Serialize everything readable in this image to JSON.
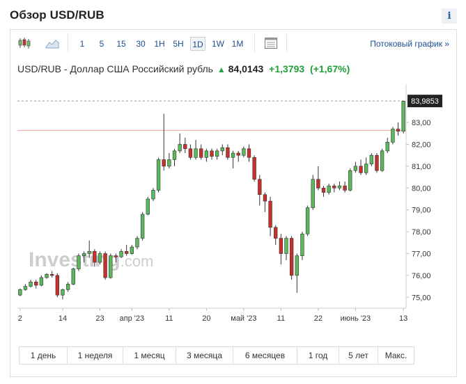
{
  "header": {
    "title": "Обзор USD/RUB",
    "info_label": "i"
  },
  "toolbar": {
    "timeframes": [
      "1",
      "5",
      "15",
      "30",
      "1H",
      "5H",
      "1D",
      "1W",
      "1M"
    ],
    "active_timeframe": "1D",
    "stream_link": "Потоковый график »"
  },
  "quote": {
    "name": "USD/RUB - Доллар США Российский рубль",
    "arrow": "▲",
    "last": "84,0143",
    "change": "+1,3793",
    "change_pct": "(+1,67%)"
  },
  "watermark": {
    "text": "Investing",
    "suffix": ".com"
  },
  "ranges": [
    "1 день",
    "1 неделя",
    "1 месяц",
    "3 месяца",
    "6 месяцев",
    "1 год",
    "5 лет",
    "Макс."
  ],
  "colors": {
    "up": "#5cb85c",
    "down": "#c9302c",
    "price_line": "#f2a3a3",
    "accent": "#1b4f8f"
  },
  "chart_data": {
    "type": "candlestick",
    "y_axis": {
      "min": 74.5,
      "max": 84.5,
      "ticks": [
        "75,00",
        "76,00",
        "77,00",
        "78,00",
        "79,00",
        "80,00",
        "81,00",
        "82,00",
        "83,00"
      ],
      "position": "right"
    },
    "x_axis": {
      "labels": [
        {
          "text": "2",
          "i": 0
        },
        {
          "text": "14",
          "i": 8
        },
        {
          "text": "23",
          "i": 15
        },
        {
          "text": "апр '23",
          "i": 21
        },
        {
          "text": "11",
          "i": 28
        },
        {
          "text": "20",
          "i": 35
        },
        {
          "text": "май '23",
          "i": 42
        },
        {
          "text": "11",
          "i": 49
        },
        {
          "text": "22",
          "i": 56
        },
        {
          "text": "июнь '23",
          "i": 63
        },
        {
          "text": "13",
          "i": 72
        }
      ]
    },
    "last_price_label": "83,9853",
    "last_price": 83.9853,
    "reference_line": 82.64,
    "candles": [
      [
        75.1,
        75.35,
        75.05,
        75.4
      ],
      [
        75.35,
        75.5,
        75.3,
        75.6
      ],
      [
        75.5,
        75.7,
        75.45,
        75.8
      ],
      [
        75.7,
        75.55,
        75.4,
        75.8
      ],
      [
        75.55,
        75.9,
        75.5,
        76.0
      ],
      [
        75.9,
        76.05,
        75.85,
        76.1
      ],
      [
        76.05,
        76.0,
        75.9,
        76.2
      ],
      [
        76.0,
        75.1,
        75.0,
        76.1
      ],
      [
        75.1,
        75.35,
        74.9,
        75.4
      ],
      [
        75.35,
        75.6,
        75.25,
        75.7
      ],
      [
        75.6,
        76.3,
        75.55,
        76.35
      ],
      [
        76.3,
        76.9,
        76.2,
        77.0
      ],
      [
        76.9,
        77.0,
        76.6,
        77.1
      ],
      [
        77.0,
        77.1,
        76.8,
        77.6
      ],
      [
        77.1,
        76.6,
        76.4,
        77.2
      ],
      [
        76.6,
        77.0,
        76.5,
        77.1
      ],
      [
        77.0,
        75.9,
        75.8,
        77.1
      ],
      [
        75.9,
        76.9,
        75.85,
        77.0
      ],
      [
        76.9,
        76.85,
        76.6,
        77.0
      ],
      [
        76.85,
        77.1,
        76.8,
        77.2
      ],
      [
        77.1,
        77.0,
        76.9,
        77.4
      ],
      [
        77.0,
        77.3,
        76.95,
        77.4
      ],
      [
        77.3,
        77.7,
        77.2,
        77.8
      ],
      [
        77.7,
        78.8,
        77.6,
        78.9
      ],
      [
        78.8,
        79.5,
        78.75,
        79.6
      ],
      [
        79.5,
        79.9,
        79.4,
        80.0
      ],
      [
        79.9,
        81.3,
        79.8,
        81.4
      ],
      [
        81.3,
        81.0,
        80.8,
        83.4
      ],
      [
        81.0,
        81.3,
        80.9,
        81.6
      ],
      [
        81.3,
        81.7,
        81.0,
        81.8
      ],
      [
        81.7,
        82.0,
        81.6,
        82.5
      ],
      [
        82.0,
        81.8,
        81.6,
        82.3
      ],
      [
        81.8,
        81.4,
        81.3,
        82.0
      ],
      [
        81.4,
        81.8,
        81.3,
        82.2
      ],
      [
        81.8,
        81.4,
        81.3,
        82.0
      ],
      [
        81.4,
        81.7,
        81.2,
        81.8
      ],
      [
        81.7,
        81.45,
        81.3,
        81.8
      ],
      [
        81.45,
        81.7,
        81.3,
        81.8
      ],
      [
        81.7,
        81.85,
        81.5,
        82.0
      ],
      [
        81.85,
        81.4,
        81.3,
        82.0
      ],
      [
        81.4,
        81.6,
        80.9,
        81.7
      ],
      [
        81.6,
        81.5,
        81.2,
        81.7
      ],
      [
        81.5,
        81.8,
        81.4,
        81.9
      ],
      [
        81.8,
        81.4,
        81.2,
        82.0
      ],
      [
        81.4,
        80.4,
        80.3,
        81.5
      ],
      [
        80.4,
        79.7,
        79.2,
        80.6
      ],
      [
        79.7,
        79.4,
        78.9,
        79.8
      ],
      [
        79.4,
        78.2,
        77.8,
        79.6
      ],
      [
        78.2,
        77.7,
        77.4,
        78.3
      ],
      [
        77.7,
        77.0,
        76.5,
        77.9
      ],
      [
        77.0,
        77.7,
        76.7,
        77.8
      ],
      [
        77.7,
        76.0,
        75.8,
        77.8
      ],
      [
        76.0,
        76.9,
        75.2,
        77.0
      ],
      [
        76.9,
        77.9,
        76.7,
        78.0
      ],
      [
        77.9,
        79.1,
        77.8,
        79.2
      ],
      [
        79.1,
        80.4,
        79.0,
        80.6
      ],
      [
        80.4,
        80.0,
        79.9,
        81.0
      ],
      [
        80.0,
        79.8,
        79.6,
        80.1
      ],
      [
        79.8,
        80.1,
        79.7,
        80.2
      ],
      [
        80.1,
        80.0,
        79.8,
        80.2
      ],
      [
        80.0,
        80.1,
        79.9,
        80.3
      ],
      [
        80.1,
        79.9,
        79.8,
        80.3
      ],
      [
        79.9,
        80.8,
        79.85,
        80.9
      ],
      [
        80.8,
        81.0,
        80.7,
        81.2
      ],
      [
        81.0,
        80.7,
        80.6,
        81.3
      ],
      [
        80.7,
        81.1,
        80.6,
        81.4
      ],
      [
        81.1,
        81.5,
        81.0,
        81.6
      ],
      [
        81.5,
        80.8,
        80.7,
        81.6
      ],
      [
        80.8,
        81.7,
        80.75,
        81.8
      ],
      [
        81.7,
        82.1,
        81.6,
        82.3
      ],
      [
        82.1,
        82.7,
        82.0,
        82.8
      ],
      [
        82.7,
        82.6,
        82.4,
        83.0
      ],
      [
        82.6,
        83.98,
        82.5,
        84.0
      ]
    ]
  }
}
